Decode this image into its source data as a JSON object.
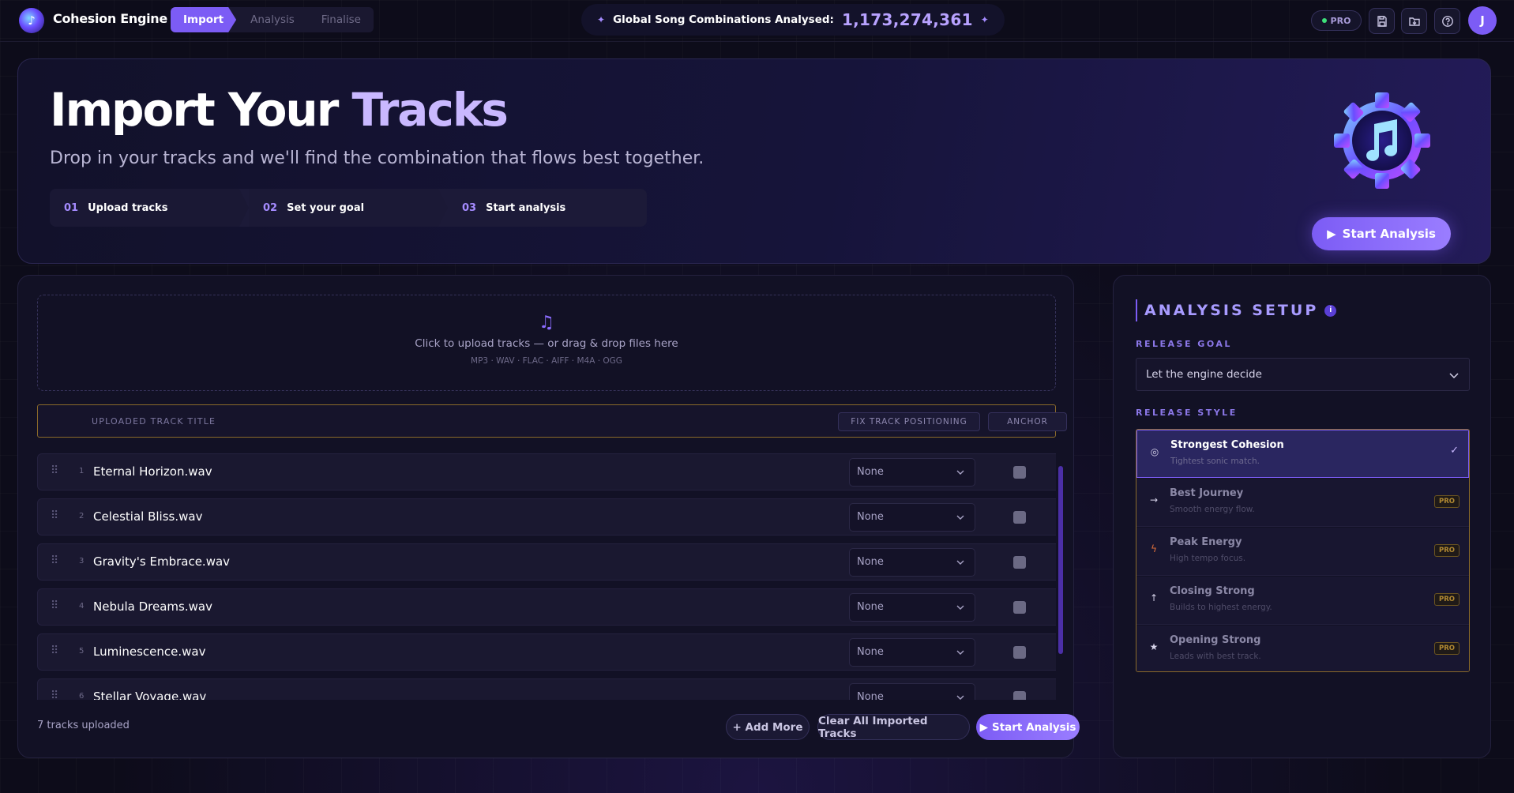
{
  "app": {
    "name": "Cohesion Engine"
  },
  "nav": {
    "steps": [
      "Import",
      "Analysis",
      "Finalise"
    ],
    "active": 0
  },
  "global_counter": {
    "label": "Global Song Combinations Analysed:",
    "value": "1,173,274,361"
  },
  "header": {
    "pro_label": "PRO",
    "avatar_initial": "J"
  },
  "hero": {
    "title_part1": "Import Your ",
    "title_part2": "Tracks",
    "subtitle": "Drop in your tracks and we'll find the combination that flows best together.",
    "steps": [
      {
        "num": "01",
        "label": "Upload tracks"
      },
      {
        "num": "02",
        "label": "Set your goal"
      },
      {
        "num": "03",
        "label": "Start analysis"
      }
    ],
    "start_label": "Start Analysis"
  },
  "upload": {
    "instruction": "Click to upload tracks — or drag & drop files here",
    "formats": "MP3 · WAV · FLAC · AIFF · M4A · OGG"
  },
  "table": {
    "title_header": "UPLOADED TRACK TITLE",
    "fix_header": "FIX TRACK POSITIONING",
    "anchor_header": "ANCHOR",
    "tracks": [
      {
        "index": "1",
        "name": "Eternal Horizon.wav",
        "position": "None"
      },
      {
        "index": "2",
        "name": "Celestial Bliss.wav",
        "position": "None"
      },
      {
        "index": "3",
        "name": "Gravity's Embrace.wav",
        "position": "None"
      },
      {
        "index": "4",
        "name": "Nebula Dreams.wav",
        "position": "None"
      },
      {
        "index": "5",
        "name": "Luminescence.wav",
        "position": "None"
      },
      {
        "index": "6",
        "name": "Stellar Voyage.wav",
        "position": "None"
      }
    ]
  },
  "tracks_footer": {
    "count_text": "7 tracks uploaded",
    "add_more": "+ Add More",
    "clear_all": "Clear All Imported Tracks",
    "start": "Start Analysis"
  },
  "setup": {
    "title": "ANALYSIS SETUP",
    "info_glyph": "i",
    "goal_label": "RELEASE GOAL",
    "goal_value": "Let the engine decide",
    "style_label": "RELEASE STYLE",
    "styles": [
      {
        "name": "Strongest Cohesion",
        "desc": "Tightest sonic match.",
        "icon": "target-icon",
        "selected": true
      },
      {
        "name": "Best Journey",
        "desc": "Smooth energy flow.",
        "icon": "arrow-right-icon",
        "badge": "PRO"
      },
      {
        "name": "Peak Energy",
        "desc": "High tempo focus.",
        "icon": "lightning-icon",
        "badge": "PRO"
      },
      {
        "name": "Closing Strong",
        "desc": "Builds to highest energy.",
        "icon": "arrow-up-icon",
        "badge": "PRO"
      },
      {
        "name": "Opening Strong",
        "desc": "Leads with best track.",
        "icon": "star-icon",
        "badge": "PRO"
      }
    ]
  },
  "colors": {
    "accent": "#7c5cf5",
    "accent_light": "#c9b8ff",
    "pro_badge": "#b28a32",
    "background": "#0d0c1a"
  }
}
